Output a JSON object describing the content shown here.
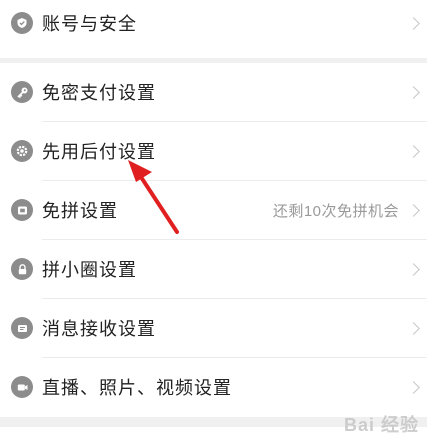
{
  "settings": {
    "items": [
      {
        "label": "账号与安全",
        "icon": "shield-icon"
      },
      {
        "label": "免密支付设置",
        "icon": "key-icon"
      },
      {
        "label": "先用后付设置",
        "icon": "gear-icon"
      },
      {
        "label": "免拼设置",
        "icon": "ticket-icon",
        "extra": "还剩10次免拼机会"
      },
      {
        "label": "拼小圈设置",
        "icon": "lock-icon"
      },
      {
        "label": "消息接收设置",
        "icon": "message-icon"
      },
      {
        "label": "直播、照片、视频设置",
        "icon": "video-icon"
      }
    ]
  },
  "colors": {
    "background": "#f0f0f0",
    "icon": "#8c8c8c",
    "text": "#222222",
    "secondary_text": "#9a9a9a",
    "annotation_arrow": "#e02020"
  }
}
